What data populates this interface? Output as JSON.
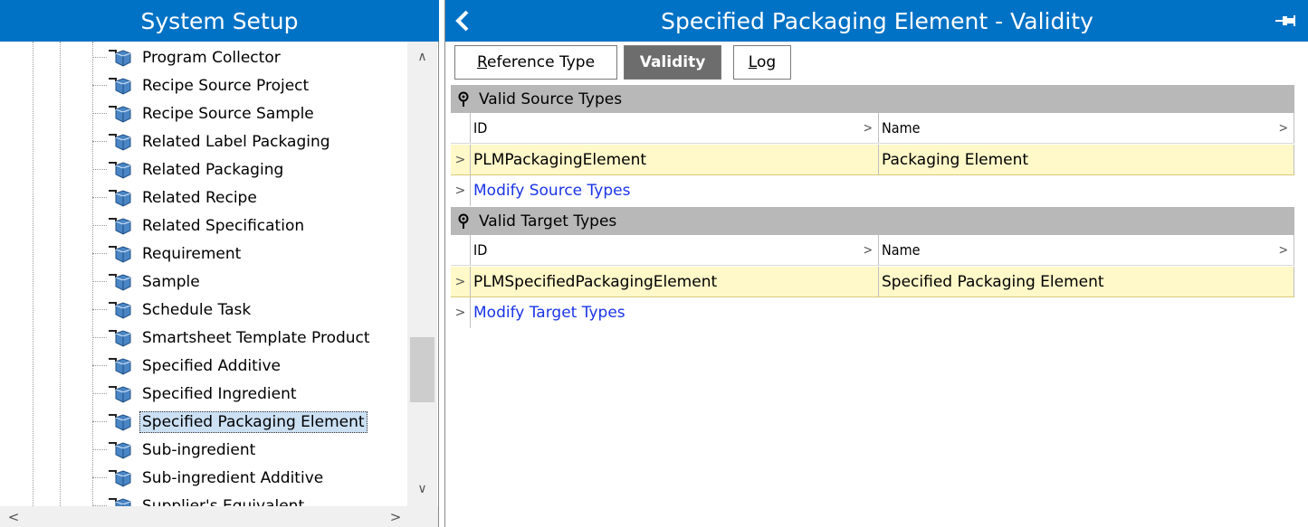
{
  "left": {
    "title": "System Setup",
    "tree_items": [
      {
        "label": "Program Collector"
      },
      {
        "label": "Recipe Source Project"
      },
      {
        "label": "Recipe Source Sample"
      },
      {
        "label": "Related Label Packaging"
      },
      {
        "label": "Related Packaging"
      },
      {
        "label": "Related Recipe"
      },
      {
        "label": "Related Specification"
      },
      {
        "label": "Requirement"
      },
      {
        "label": "Sample"
      },
      {
        "label": "Schedule Task"
      },
      {
        "label": "Smartsheet Template Product"
      },
      {
        "label": "Specified Additive"
      },
      {
        "label": "Specified Ingredient"
      },
      {
        "label": "Specified Packaging Element",
        "selected": true
      },
      {
        "label": "Sub-ingredient"
      },
      {
        "label": "Sub-ingredient Additive"
      },
      {
        "label": "Supplier's Equivalent"
      }
    ],
    "scroll_up": "∧",
    "scroll_down": "∨",
    "scroll_left": "<",
    "scroll_right": ">"
  },
  "right": {
    "title": "Specified Packaging Element - Validity",
    "back_icon": "chevron-left-icon",
    "pin_icon": "pin-icon",
    "tabs": [
      {
        "prefix": "R",
        "rest": "eference Type"
      },
      {
        "label": "Validity",
        "active": true
      },
      {
        "prefix": "L",
        "rest": "og"
      }
    ],
    "sections": [
      {
        "title": "Valid Source Types",
        "col_id": "ID",
        "col_name": "Name",
        "row_id": "PLMPackagingElement",
        "row_name": "Packaging Element",
        "action": "Modify Source Types"
      },
      {
        "title": "Valid Target Types",
        "col_id": "ID",
        "col_name": "Name",
        "row_id": "PLMSpecifiedPackagingElement",
        "row_name": "Specified Packaging Element",
        "action": "Modify Target Types"
      }
    ],
    "row_indicator": ">",
    "col_arrow": ">"
  },
  "colors": {
    "header_blue": "#0072c6",
    "section_grey": "#b8b8b8",
    "row_highlight": "#fff8c9",
    "link_blue": "#1a34e6",
    "selected_bg": "#cce0f4"
  }
}
